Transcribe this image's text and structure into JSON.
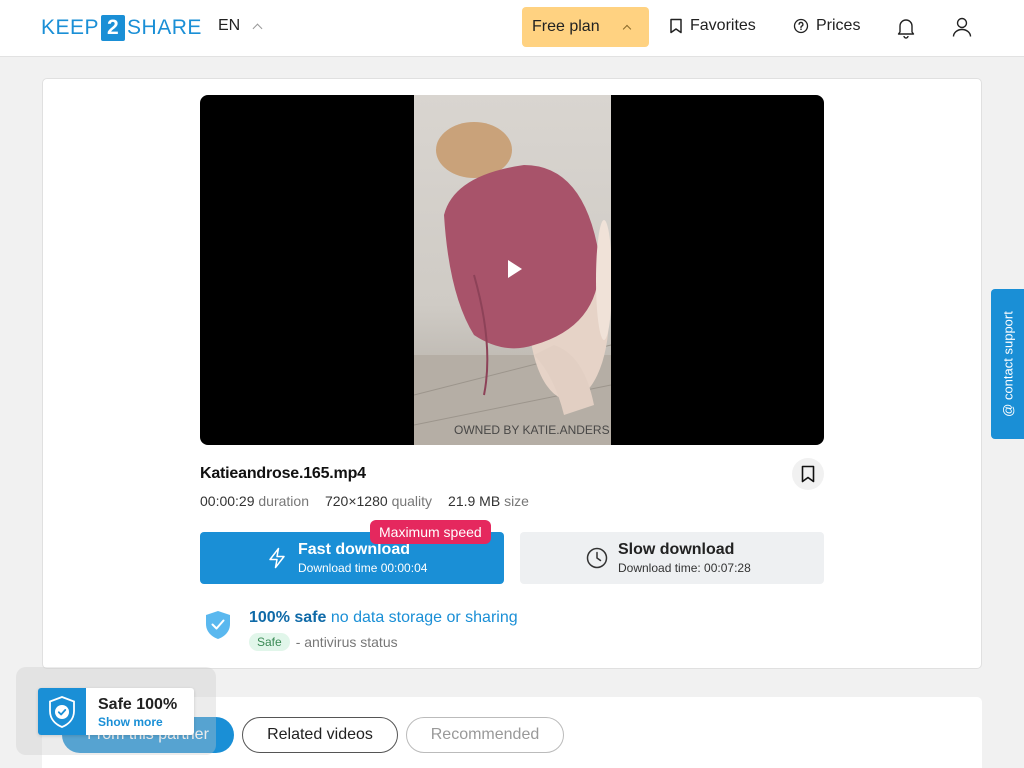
{
  "header": {
    "logo": {
      "left": "KEEP",
      "digit": "2",
      "right": "SHARE"
    },
    "language": "EN",
    "plan_label": "Free plan",
    "favorites_label": "Favorites",
    "prices_label": "Prices"
  },
  "video": {
    "watermark": "OWNED BY KATIE.ANDERS"
  },
  "file": {
    "name": "Katieandrose.165.mp4",
    "duration_value": "00:00:29",
    "duration_label": "duration",
    "quality_value": "720×1280",
    "quality_label": "quality",
    "size_value": "21.9 MB",
    "size_label": "size"
  },
  "download": {
    "fast_title": "Fast download",
    "fast_subtitle": "Download time 00:00:04",
    "fast_badge": "Maximum speed",
    "slow_title": "Slow download",
    "slow_subtitle": "Download time: 00:07:28"
  },
  "safety": {
    "strong": "100% safe",
    "light": "no data storage or sharing",
    "pill": "Safe",
    "status_text": "- antivirus status"
  },
  "support_tab": "@ contact support",
  "tabs": [
    {
      "label": "From this partner"
    },
    {
      "label": "Related videos"
    },
    {
      "label": "Recommended"
    }
  ],
  "safe_widget": {
    "title": "Safe 100%",
    "link": "Show more"
  },
  "colors": {
    "accent": "#1a8fd6",
    "plan_bg": "#ffd281",
    "badge_red": "#e5285e",
    "safe_green_bg": "#e1f6ea"
  },
  "icons": {
    "favorites": "bookmark-icon",
    "prices": "question-circle-icon",
    "notifications": "bell-icon",
    "account": "user-icon",
    "fast": "lightning-icon",
    "slow": "clock-icon",
    "safety": "shield-check-icon"
  }
}
